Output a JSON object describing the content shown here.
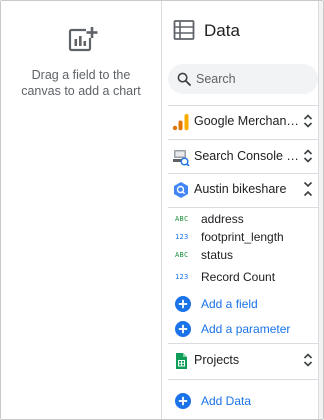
{
  "canvas": {
    "hint_line1": "Drag a field to the",
    "hint_line2": "canvas to add a chart",
    "icon": "add-chart-icon"
  },
  "panel": {
    "title": "Data",
    "icon": "table-icon"
  },
  "search": {
    "placeholder": "Search"
  },
  "sources": [
    {
      "name": "Google Merchandi...",
      "icon": "analytics-icon",
      "expanded": false
    },
    {
      "name": "Search Console htt...",
      "icon": "search-console-icon",
      "expanded": false
    },
    {
      "name": "Austin bikeshare",
      "icon": "bigquery-icon",
      "expanded": true
    }
  ],
  "fields": [
    {
      "type": "ABC",
      "name": "address"
    },
    {
      "type": "123",
      "name": "footprint_length"
    },
    {
      "type": "ABC",
      "name": "status"
    },
    {
      "type": "123",
      "name": "Record Count"
    }
  ],
  "actions": {
    "add_field": "Add a field",
    "add_parameter": "Add a parameter"
  },
  "projects_source": {
    "name": "Projects",
    "icon": "sheets-icon",
    "expanded": false
  },
  "add_data": "Add Data",
  "colors": {
    "accent": "#1a73e8",
    "text_type": "#1e8e3e",
    "number_type": "#1a73e8",
    "divider": "#dadce0"
  }
}
